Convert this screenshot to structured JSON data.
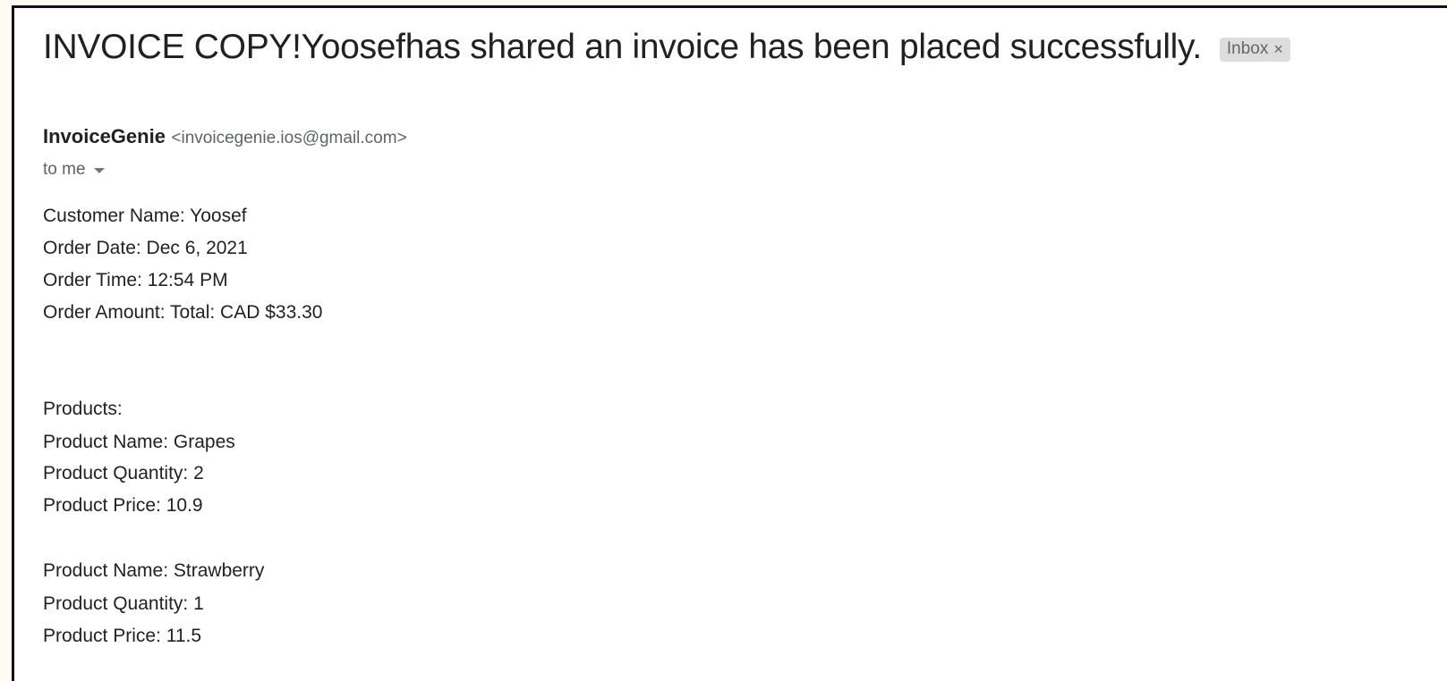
{
  "email": {
    "subject": "INVOICE COPY!Yoosefhas shared an invoice has been placed successfully.",
    "label": "Inbox",
    "label_close": "×",
    "sender_name": "InvoiceGenie",
    "sender_email": "<invoicegenie.ios@gmail.com>",
    "recipient": "to me"
  },
  "body": {
    "customer_name": "Customer Name: Yoosef",
    "order_date": "Order Date: Dec 6, 2021",
    "order_time": "Order Time: 12:54 PM",
    "order_amount": "Order Amount: Total: CAD $33.30",
    "products_heading": "Products:",
    "products": [
      {
        "name": "Product Name: Grapes",
        "quantity": "Product Quantity: 2",
        "price": "Product Price: 10.9"
      },
      {
        "name": "Product Name: Strawberry",
        "quantity": "Product Quantity: 1",
        "price": "Product Price: 11.5"
      }
    ]
  },
  "icons": {
    "recipient_dropdown": "chevron-down-icon",
    "label_remove": "close-icon"
  }
}
